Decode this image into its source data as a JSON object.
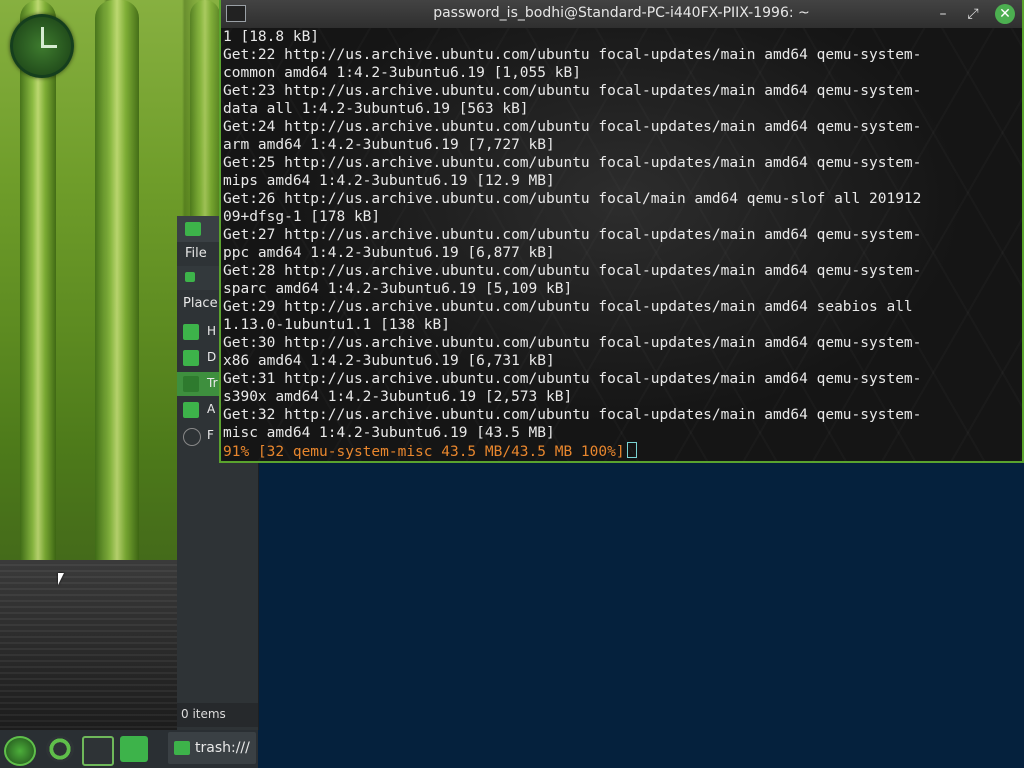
{
  "terminal": {
    "title": "password_is_bodhi@Standard-PC-i440FX-PIIX-1996: ~",
    "lines": [
      "1 [18.8 kB]",
      "Get:22 http://us.archive.ubuntu.com/ubuntu focal-updates/main amd64 qemu-system-",
      "common amd64 1:4.2-3ubuntu6.19 [1,055 kB]",
      "Get:23 http://us.archive.ubuntu.com/ubuntu focal-updates/main amd64 qemu-system-",
      "data all 1:4.2-3ubuntu6.19 [563 kB]",
      "Get:24 http://us.archive.ubuntu.com/ubuntu focal-updates/main amd64 qemu-system-",
      "arm amd64 1:4.2-3ubuntu6.19 [7,727 kB]",
      "Get:25 http://us.archive.ubuntu.com/ubuntu focal-updates/main amd64 qemu-system-",
      "mips amd64 1:4.2-3ubuntu6.19 [12.9 MB]",
      "Get:26 http://us.archive.ubuntu.com/ubuntu focal/main amd64 qemu-slof all 201912",
      "09+dfsg-1 [178 kB]",
      "Get:27 http://us.archive.ubuntu.com/ubuntu focal-updates/main amd64 qemu-system-",
      "ppc amd64 1:4.2-3ubuntu6.19 [6,877 kB]",
      "Get:28 http://us.archive.ubuntu.com/ubuntu focal-updates/main amd64 qemu-system-",
      "sparc amd64 1:4.2-3ubuntu6.19 [5,109 kB]",
      "Get:29 http://us.archive.ubuntu.com/ubuntu focal-updates/main amd64 seabios all",
      "1.13.0-1ubuntu1.1 [138 kB]",
      "Get:30 http://us.archive.ubuntu.com/ubuntu focal-updates/main amd64 qemu-system-",
      "x86 amd64 1:4.2-3ubuntu6.19 [6,731 kB]",
      "Get:31 http://us.archive.ubuntu.com/ubuntu focal-updates/main amd64 qemu-system-",
      "s390x amd64 1:4.2-3ubuntu6.19 [2,573 kB]",
      "Get:32 http://us.archive.ubuntu.com/ubuntu focal-updates/main amd64 qemu-system-",
      "misc amd64 1:4.2-3ubuntu6.19 [43.5 MB]"
    ],
    "progress_line": "91% [32 qemu-system-misc 43.5 MB/43.5 MB 100%]",
    "buttons": {
      "minimize": "–",
      "maximize": "⤢",
      "close": "✕"
    }
  },
  "file_manager": {
    "menu_file": "File",
    "places_label": "Place",
    "items": [
      "H",
      "D",
      "Tr",
      "A",
      "F"
    ],
    "status": "0 items"
  },
  "taskbar": {
    "task_label": "trash:///",
    "icons": [
      "bodhi-menu-icon",
      "chromium-icon",
      "terminal-icon",
      "file-manager-icon"
    ]
  },
  "colors": {
    "accent": "#3db34a",
    "progress": "#e8862d",
    "desktop_blue": "#05213d"
  }
}
